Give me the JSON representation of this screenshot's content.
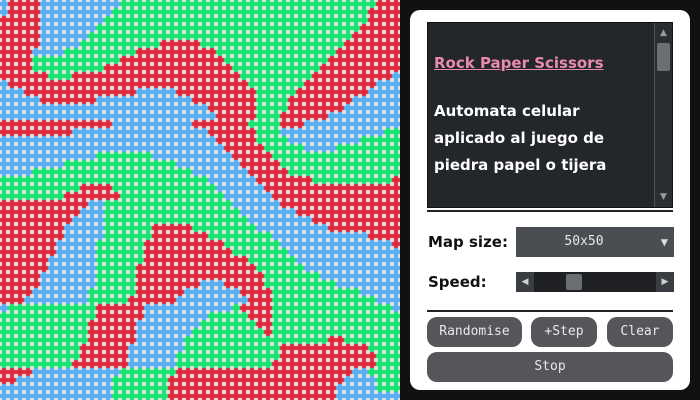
{
  "grid": {
    "colors": {
      "red": "#e0283c",
      "green": "#18e472",
      "blue": "#58aef0"
    }
  },
  "info": {
    "title": "Rock Paper Scissors",
    "description": "Automata celular aplicado al juego de piedra papel o tijera"
  },
  "controls": {
    "map_size_label": "Map size:",
    "map_size_value": "50x50",
    "speed_label": "Speed:",
    "speed_value": 0.3
  },
  "buttons": {
    "randomise": "Randomise",
    "step": "+Step",
    "clear": "Clear",
    "stop": "Stop"
  }
}
